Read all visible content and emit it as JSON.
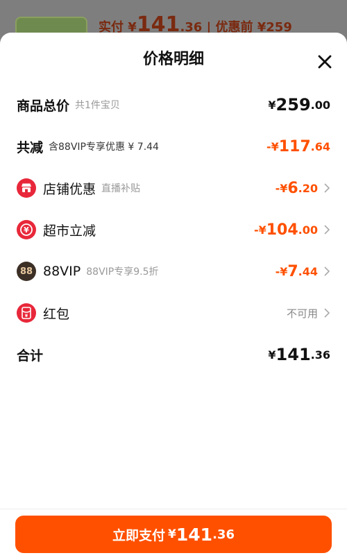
{
  "colors": {
    "accent": "#ff5000",
    "text": "#111111",
    "muted": "#999999",
    "vip_bg": "#3b2f26",
    "vip_fg": "#e8c9a0",
    "red_icon": "#e8283a"
  },
  "background_page": {
    "paid_label": "实付",
    "paid_yen": "¥",
    "paid_int": "141",
    "paid_dec": ".36",
    "separator": "|",
    "original_label": "优惠前",
    "original_price": "¥259"
  },
  "sheet": {
    "title": "价格明细"
  },
  "rows": {
    "total": {
      "label": "商品总价",
      "sub": "共1件宝贝",
      "yen": "¥",
      "int": "259",
      "dec": ".00"
    },
    "reduced": {
      "label": "共减",
      "sub": "含88VIP专享优惠 ¥ 7.44",
      "sign_yen": "-¥",
      "int": "117",
      "dec": ".64"
    },
    "store": {
      "icon": "store-icon",
      "label": "店铺优惠",
      "sub": "直播补贴",
      "sign_yen": "-¥",
      "int": "6",
      "dec": ".20"
    },
    "supermarket": {
      "icon": "yen-coin-icon",
      "label": "超市立减",
      "sign_yen": "-¥",
      "int": "104",
      "dec": ".00"
    },
    "vip": {
      "icon": "88vip-icon",
      "icon_text": "88",
      "label": "88VIP",
      "sub": "88VIP专享9.5折",
      "sign_yen": "-¥",
      "int": "7",
      "dec": ".44"
    },
    "redpacket": {
      "icon": "red-packet-icon",
      "label": "红包",
      "status": "不可用"
    },
    "sum": {
      "label": "合计",
      "yen": "¥",
      "int": "141",
      "dec": ".36"
    }
  },
  "footer": {
    "pay_label": "立即支付",
    "yen": "¥",
    "int": "141",
    "dec": ".36"
  }
}
